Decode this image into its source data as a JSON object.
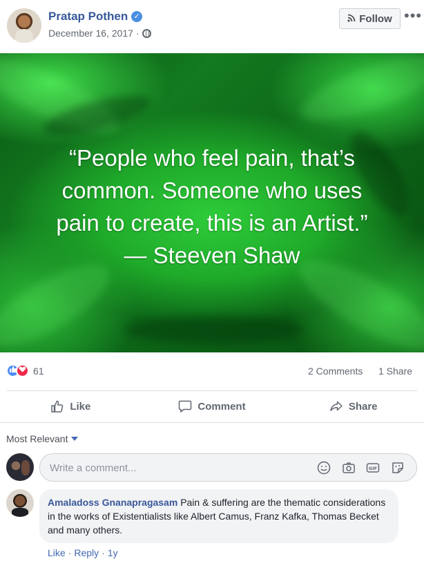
{
  "post": {
    "author": "Pratap Pothen",
    "date": "December 16, 2017 ·",
    "follow_label": "Follow",
    "more_label": "•••"
  },
  "quote": {
    "line1": "“People who feel pain, that’s",
    "line2": "common. Someone who uses",
    "line3": "pain to create, this is an Artist.”",
    "line4": "— Steeven Shaw"
  },
  "stats": {
    "reaction_count": "61",
    "comments": "2 Comments",
    "shares": "1 Share"
  },
  "actions": {
    "like": "Like",
    "comment": "Comment",
    "share": "Share"
  },
  "comments_section": {
    "sort_label": "Most Relevant",
    "input_placeholder": "Write a comment...",
    "items": [
      {
        "name": "Amaladoss Gnanapragasam",
        "text": "Pain & suffering are the thematic considerations in the works of Existentialists like Albert Camus, Franz Kafka, Thomas Becket and many others.",
        "like": "Like",
        "reply": "Reply",
        "age": "1y"
      }
    ]
  },
  "colors": {
    "link_blue": "#365899",
    "like_blue": "#4a8bf5",
    "love_red": "#f0284a",
    "background_green": "#1faa2a"
  }
}
